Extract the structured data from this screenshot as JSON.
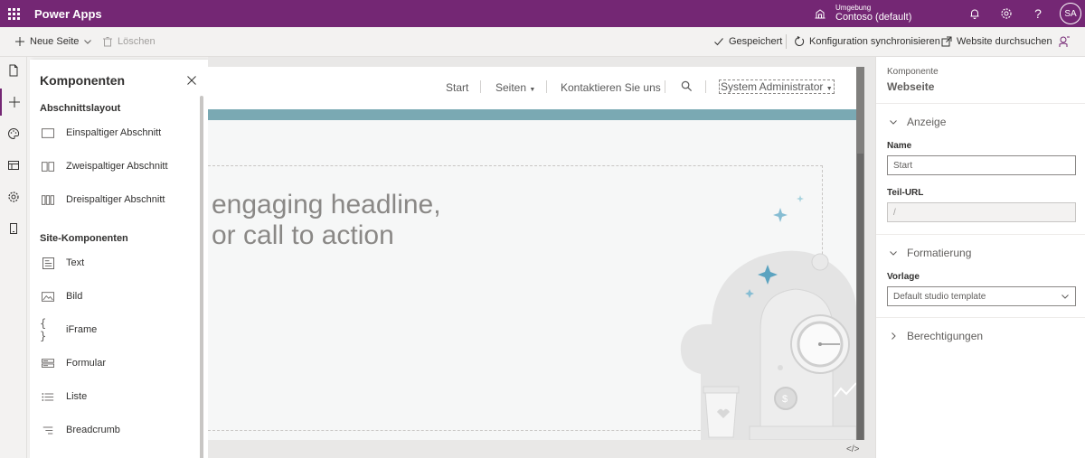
{
  "appbar": {
    "title": "Power Apps",
    "environment_label": "Umgebung",
    "environment_name": "Contoso (default)",
    "avatar_initials": "SA",
    "accent_color": "#742774"
  },
  "cmdbar": {
    "new_page": "Neue Seite",
    "delete": "Löschen",
    "saved": "Gespeichert",
    "sync_config": "Konfiguration synchronisieren",
    "browse_site": "Website durchsuchen"
  },
  "panel": {
    "title": "Komponenten",
    "section_layout": "Abschnittslayout",
    "layout_items": [
      {
        "label": "Einspaltiger Abschnitt",
        "icon": "one-column-icon"
      },
      {
        "label": "Zweispaltiger Abschnitt",
        "icon": "two-column-icon"
      },
      {
        "label": "Dreispaltiger Abschnitt",
        "icon": "three-column-icon"
      }
    ],
    "section_components": "Site-Komponenten",
    "component_items": [
      {
        "label": "Text",
        "icon": "text-icon"
      },
      {
        "label": "Bild",
        "icon": "image-icon"
      },
      {
        "label": "iFrame",
        "icon": "braces-icon"
      },
      {
        "label": "Formular",
        "icon": "form-icon"
      },
      {
        "label": "Liste",
        "icon": "list-icon"
      },
      {
        "label": "Breadcrumb",
        "icon": "breadcrumb-icon"
      }
    ]
  },
  "site": {
    "nav": {
      "start": "Start",
      "pages": "Seiten",
      "contact": "Kontaktieren Sie uns",
      "user": "System Administrator"
    },
    "headline_line1": "engaging headline,",
    "headline_line2": "or call to action",
    "band_color": "#7aa9b3"
  },
  "props": {
    "subtitle": "Komponente",
    "title": "Webseite",
    "group_display": "Anzeige",
    "name_label": "Name",
    "name_value": "Start",
    "url_label": "Teil-URL",
    "url_value": "/",
    "group_format": "Formatierung",
    "template_label": "Vorlage",
    "template_value": "Default studio template",
    "group_permissions": "Berechtigungen"
  }
}
